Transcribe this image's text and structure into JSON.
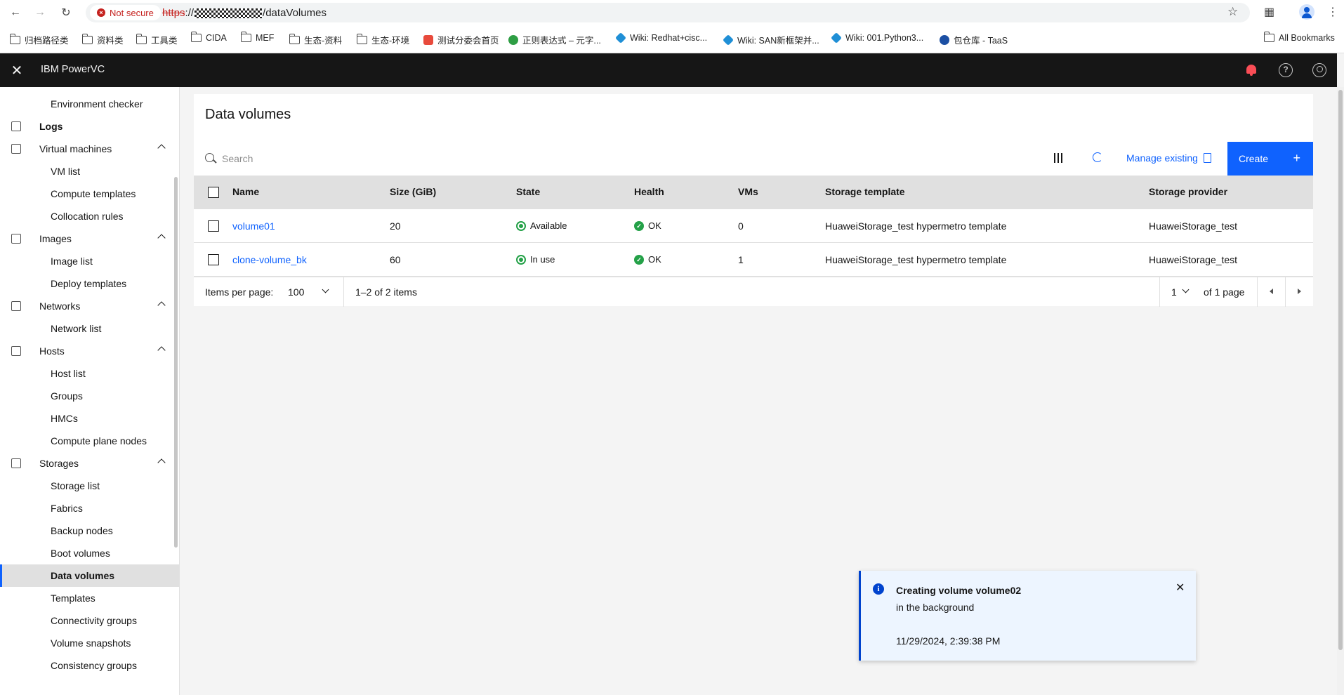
{
  "browser": {
    "security_label": "Not secure",
    "url_scheme": "https",
    "url_path": "/dataVolumes",
    "bookmarks": [
      {
        "label": "归档路径类",
        "icon": "folder-icon"
      },
      {
        "label": "资料类",
        "icon": "folder-icon"
      },
      {
        "label": "工具类",
        "icon": "folder-icon"
      },
      {
        "label": "CIDA",
        "icon": "folder-icon"
      },
      {
        "label": "MEF",
        "icon": "folder-icon"
      },
      {
        "label": "生态-资料",
        "icon": "folder-icon"
      },
      {
        "label": "生态-环境",
        "icon": "folder-icon"
      },
      {
        "label": "测试分委会首页",
        "icon": "site-icon"
      },
      {
        "label": "正则表达式 – 元字...",
        "icon": "site-icon"
      },
      {
        "label": "Wiki: Redhat+cisc...",
        "icon": "wiki-icon"
      },
      {
        "label": "Wiki: SAN新框架并...",
        "icon": "wiki-icon"
      },
      {
        "label": "Wiki: 001.Python3...",
        "icon": "wiki-icon"
      },
      {
        "label": "包仓库 - TaaS",
        "icon": "site-icon"
      }
    ],
    "all_bookmarks": "All Bookmarks"
  },
  "header": {
    "product_name": "IBM PowerVC"
  },
  "sidebar": {
    "items": [
      {
        "label": "Environment checker",
        "level": "sub"
      },
      {
        "label": "Logs",
        "level": "top",
        "icon": "logs-icon"
      },
      {
        "label": "Virtual machines",
        "level": "top",
        "icon": "monitor-icon",
        "expanded": true
      },
      {
        "label": "VM list",
        "level": "sub"
      },
      {
        "label": "Compute templates",
        "level": "sub"
      },
      {
        "label": "Collocation rules",
        "level": "sub"
      },
      {
        "label": "Images",
        "level": "top",
        "icon": "camera-icon",
        "expanded": true
      },
      {
        "label": "Image list",
        "level": "sub"
      },
      {
        "label": "Deploy templates",
        "level": "sub"
      },
      {
        "label": "Networks",
        "level": "top",
        "icon": "network-icon",
        "expanded": true
      },
      {
        "label": "Network list",
        "level": "sub"
      },
      {
        "label": "Hosts",
        "level": "top",
        "icon": "server-icon",
        "expanded": true
      },
      {
        "label": "Host list",
        "level": "sub"
      },
      {
        "label": "Groups",
        "level": "sub"
      },
      {
        "label": "HMCs",
        "level": "sub"
      },
      {
        "label": "Compute plane nodes",
        "level": "sub"
      },
      {
        "label": "Storages",
        "level": "top",
        "icon": "storage-icon",
        "expanded": true
      },
      {
        "label": "Storage list",
        "level": "sub"
      },
      {
        "label": "Fabrics",
        "level": "sub"
      },
      {
        "label": "Backup nodes",
        "level": "sub"
      },
      {
        "label": "Boot volumes",
        "level": "sub"
      },
      {
        "label": "Data volumes",
        "level": "sub",
        "active": true
      },
      {
        "label": "Templates",
        "level": "sub"
      },
      {
        "label": "Connectivity groups",
        "level": "sub"
      },
      {
        "label": "Volume snapshots",
        "level": "sub"
      },
      {
        "label": "Consistency groups",
        "level": "sub"
      }
    ]
  },
  "main": {
    "title": "Data volumes",
    "search_placeholder": "Search",
    "manage_existing": "Manage existing",
    "create_label": "Create",
    "columns": [
      "Name",
      "Size (GiB)",
      "State",
      "Health",
      "VMs",
      "Storage template",
      "Storage provider"
    ],
    "rows": [
      {
        "name": "volume01",
        "size": "20",
        "state": "Available",
        "health": "OK",
        "vms": "0",
        "template": "HuaweiStorage_test hypermetro template",
        "provider": "HuaweiStorage_test"
      },
      {
        "name": "clone-volume_bk",
        "size": "60",
        "state": "In use",
        "health": "OK",
        "vms": "1",
        "template": "HuaweiStorage_test hypermetro template",
        "provider": "HuaweiStorage_test"
      }
    ],
    "pagination": {
      "items_per_page_label": "Items per page:",
      "items_per_page": "100",
      "range": "1–2 of 2 items",
      "page": "1",
      "of_pages": "of 1 page"
    }
  },
  "notification": {
    "title": "Creating volume volume02",
    "subtitle": "in the background",
    "timestamp": "11/29/2024, 2:39:38 PM"
  },
  "colors": {
    "accent": "#0f62fe",
    "success": "#24a148",
    "alert": "#fa4d56"
  }
}
